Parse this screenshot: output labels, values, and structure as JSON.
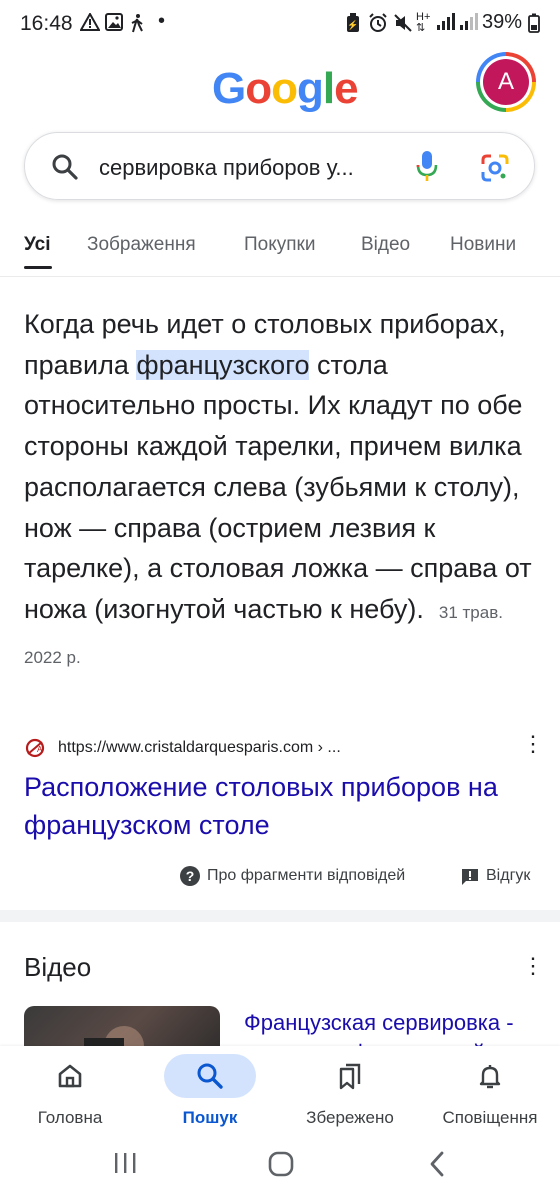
{
  "status_bar": {
    "time": "16:48",
    "battery": "39%"
  },
  "header": {
    "logo_letters": [
      "G",
      "o",
      "o",
      "g",
      "l",
      "e"
    ],
    "logo_colors": [
      "#4285f4",
      "#ea4335",
      "#fbbc05",
      "#4285f4",
      "#34a853",
      "#ea4335"
    ],
    "avatar_letter": "A"
  },
  "search": {
    "query": "сервировка приборов у..."
  },
  "tabs": [
    {
      "label": "Усі",
      "active": true
    },
    {
      "label": "Зображення"
    },
    {
      "label": "Покупки"
    },
    {
      "label": "Відео"
    },
    {
      "label": "Новини"
    }
  ],
  "snippet": {
    "text_before": "Когда речь идет о столовых приборах, правила ",
    "highlight": "французского",
    "text_after": " стола относительно просты. Их кладут по обе стороны каждой тарелки, причем вилка располагается слева (зубьями к столу), нож — справа (острием лезвия к тарелке), а столовая ложка — справа от ножа (изогнутой частью к небу).",
    "date": "31 трав. 2022 р."
  },
  "result": {
    "url": "https://www.cristaldarquesparis.com › ...",
    "title": "Расположение столовых приборов на французском столе"
  },
  "feedback": {
    "about_label": "Про фрагменти відповідей",
    "feedback_label": "Відгук"
  },
  "videos": {
    "heading": "Відео",
    "first_title": "Французская сервировка - принципы французской"
  },
  "bottom_nav": [
    {
      "label": "Головна",
      "icon": "home-icon"
    },
    {
      "label": "Пошук",
      "icon": "search-icon",
      "active": true
    },
    {
      "label": "Збережено",
      "icon": "bookmarks-icon"
    },
    {
      "label": "Сповіщення",
      "icon": "bell-icon"
    }
  ],
  "colors": {
    "link": "#1a0dab",
    "accent": "#0b57d0",
    "highlight": "#d3e3fd"
  }
}
